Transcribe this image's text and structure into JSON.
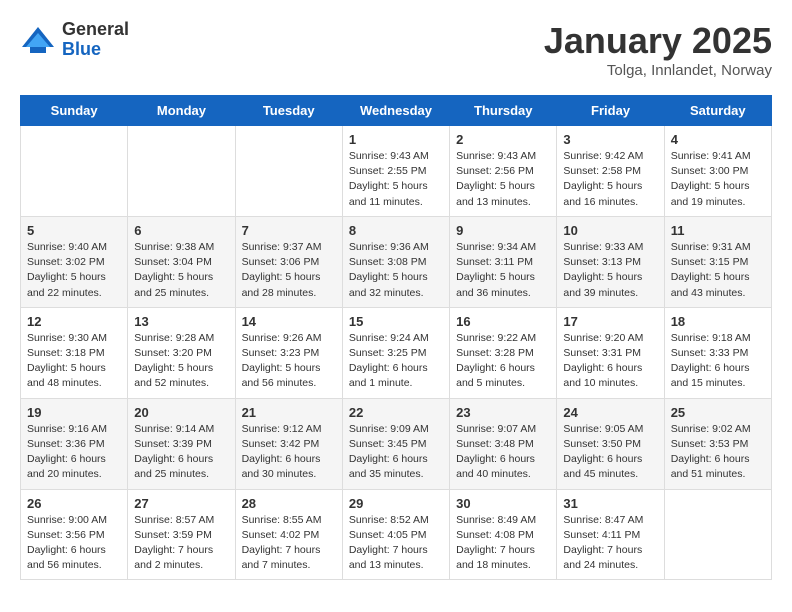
{
  "header": {
    "logo_general": "General",
    "logo_blue": "Blue",
    "title": "January 2025",
    "location": "Tolga, Innlandet, Norway"
  },
  "weekdays": [
    "Sunday",
    "Monday",
    "Tuesday",
    "Wednesday",
    "Thursday",
    "Friday",
    "Saturday"
  ],
  "weeks": [
    [
      {
        "day": "",
        "info": ""
      },
      {
        "day": "",
        "info": ""
      },
      {
        "day": "",
        "info": ""
      },
      {
        "day": "1",
        "info": "Sunrise: 9:43 AM\nSunset: 2:55 PM\nDaylight: 5 hours\nand 11 minutes."
      },
      {
        "day": "2",
        "info": "Sunrise: 9:43 AM\nSunset: 2:56 PM\nDaylight: 5 hours\nand 13 minutes."
      },
      {
        "day": "3",
        "info": "Sunrise: 9:42 AM\nSunset: 2:58 PM\nDaylight: 5 hours\nand 16 minutes."
      },
      {
        "day": "4",
        "info": "Sunrise: 9:41 AM\nSunset: 3:00 PM\nDaylight: 5 hours\nand 19 minutes."
      }
    ],
    [
      {
        "day": "5",
        "info": "Sunrise: 9:40 AM\nSunset: 3:02 PM\nDaylight: 5 hours\nand 22 minutes."
      },
      {
        "day": "6",
        "info": "Sunrise: 9:38 AM\nSunset: 3:04 PM\nDaylight: 5 hours\nand 25 minutes."
      },
      {
        "day": "7",
        "info": "Sunrise: 9:37 AM\nSunset: 3:06 PM\nDaylight: 5 hours\nand 28 minutes."
      },
      {
        "day": "8",
        "info": "Sunrise: 9:36 AM\nSunset: 3:08 PM\nDaylight: 5 hours\nand 32 minutes."
      },
      {
        "day": "9",
        "info": "Sunrise: 9:34 AM\nSunset: 3:11 PM\nDaylight: 5 hours\nand 36 minutes."
      },
      {
        "day": "10",
        "info": "Sunrise: 9:33 AM\nSunset: 3:13 PM\nDaylight: 5 hours\nand 39 minutes."
      },
      {
        "day": "11",
        "info": "Sunrise: 9:31 AM\nSunset: 3:15 PM\nDaylight: 5 hours\nand 43 minutes."
      }
    ],
    [
      {
        "day": "12",
        "info": "Sunrise: 9:30 AM\nSunset: 3:18 PM\nDaylight: 5 hours\nand 48 minutes."
      },
      {
        "day": "13",
        "info": "Sunrise: 9:28 AM\nSunset: 3:20 PM\nDaylight: 5 hours\nand 52 minutes."
      },
      {
        "day": "14",
        "info": "Sunrise: 9:26 AM\nSunset: 3:23 PM\nDaylight: 5 hours\nand 56 minutes."
      },
      {
        "day": "15",
        "info": "Sunrise: 9:24 AM\nSunset: 3:25 PM\nDaylight: 6 hours\nand 1 minute."
      },
      {
        "day": "16",
        "info": "Sunrise: 9:22 AM\nSunset: 3:28 PM\nDaylight: 6 hours\nand 5 minutes."
      },
      {
        "day": "17",
        "info": "Sunrise: 9:20 AM\nSunset: 3:31 PM\nDaylight: 6 hours\nand 10 minutes."
      },
      {
        "day": "18",
        "info": "Sunrise: 9:18 AM\nSunset: 3:33 PM\nDaylight: 6 hours\nand 15 minutes."
      }
    ],
    [
      {
        "day": "19",
        "info": "Sunrise: 9:16 AM\nSunset: 3:36 PM\nDaylight: 6 hours\nand 20 minutes."
      },
      {
        "day": "20",
        "info": "Sunrise: 9:14 AM\nSunset: 3:39 PM\nDaylight: 6 hours\nand 25 minutes."
      },
      {
        "day": "21",
        "info": "Sunrise: 9:12 AM\nSunset: 3:42 PM\nDaylight: 6 hours\nand 30 minutes."
      },
      {
        "day": "22",
        "info": "Sunrise: 9:09 AM\nSunset: 3:45 PM\nDaylight: 6 hours\nand 35 minutes."
      },
      {
        "day": "23",
        "info": "Sunrise: 9:07 AM\nSunset: 3:48 PM\nDaylight: 6 hours\nand 40 minutes."
      },
      {
        "day": "24",
        "info": "Sunrise: 9:05 AM\nSunset: 3:50 PM\nDaylight: 6 hours\nand 45 minutes."
      },
      {
        "day": "25",
        "info": "Sunrise: 9:02 AM\nSunset: 3:53 PM\nDaylight: 6 hours\nand 51 minutes."
      }
    ],
    [
      {
        "day": "26",
        "info": "Sunrise: 9:00 AM\nSunset: 3:56 PM\nDaylight: 6 hours\nand 56 minutes."
      },
      {
        "day": "27",
        "info": "Sunrise: 8:57 AM\nSunset: 3:59 PM\nDaylight: 7 hours\nand 2 minutes."
      },
      {
        "day": "28",
        "info": "Sunrise: 8:55 AM\nSunset: 4:02 PM\nDaylight: 7 hours\nand 7 minutes."
      },
      {
        "day": "29",
        "info": "Sunrise: 8:52 AM\nSunset: 4:05 PM\nDaylight: 7 hours\nand 13 minutes."
      },
      {
        "day": "30",
        "info": "Sunrise: 8:49 AM\nSunset: 4:08 PM\nDaylight: 7 hours\nand 18 minutes."
      },
      {
        "day": "31",
        "info": "Sunrise: 8:47 AM\nSunset: 4:11 PM\nDaylight: 7 hours\nand 24 minutes."
      },
      {
        "day": "",
        "info": ""
      }
    ]
  ]
}
